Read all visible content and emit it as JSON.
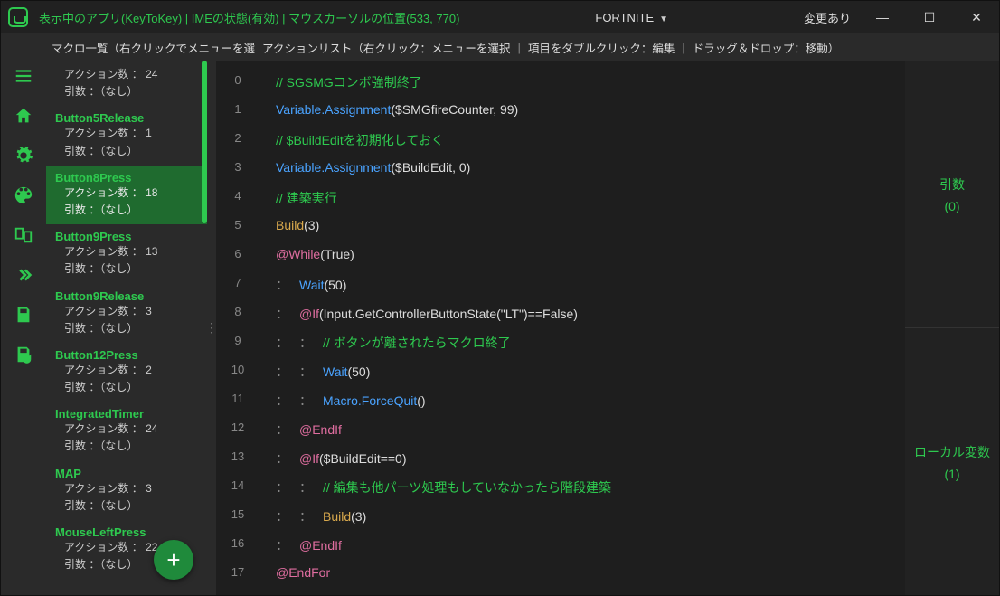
{
  "titlebar": {
    "status": "表示中のアプリ(KeyToKey)  |  IMEの状態(有効)  |  マウスカーソルの位置(533, 770)",
    "profile": "FORTNITE",
    "changed": "変更あり"
  },
  "subheader": {
    "left": "マクロ一覧（右クリックでメニューを選",
    "mid": "アクションリスト（右クリック：メニューを選択 ｜ 項目をダブルクリック：編集 ｜ ドラッグ＆ドロップ：移動）"
  },
  "macros": [
    {
      "name": "",
      "actions": "アクション数 ： 24",
      "args": "引数 ：（なし）",
      "partial": true
    },
    {
      "name": "Button5Release",
      "actions": "アクション数 ： 1",
      "args": "引数 ：（なし）"
    },
    {
      "name": "Button8Press",
      "actions": "アクション数 ： 18",
      "args": "引数 ：（なし）",
      "selected": true
    },
    {
      "name": "Button9Press",
      "actions": "アクション数 ： 13",
      "args": "引数 ：（なし）"
    },
    {
      "name": "Button9Release",
      "actions": "アクション数 ： 3",
      "args": "引数 ：（なし）"
    },
    {
      "name": "Button12Press",
      "actions": "アクション数 ： 2",
      "args": "引数 ：（なし）"
    },
    {
      "name": "IntegratedTimer",
      "actions": "アクション数 ： 24",
      "args": "引数 ：（なし）"
    },
    {
      "name": "MAP",
      "actions": "アクション数 ： 3",
      "args": "引数 ：（なし）"
    },
    {
      "name": "MouseLeftPress",
      "actions": "アクション数 ： 22",
      "args": "引数 ：（なし）"
    }
  ],
  "code": [
    {
      "n": 0,
      "indent": 0,
      "tokens": [
        {
          "t": "comment",
          "v": "// SGSMGコンボ強制終了"
        }
      ]
    },
    {
      "n": 1,
      "indent": 0,
      "tokens": [
        {
          "t": "func",
          "v": "Variable.Assignment"
        },
        {
          "t": "plain",
          "v": "($SMGfireCounter, 99)"
        }
      ]
    },
    {
      "n": 2,
      "indent": 0,
      "tokens": [
        {
          "t": "comment",
          "v": "// $BuildEditを初期化しておく"
        }
      ]
    },
    {
      "n": 3,
      "indent": 0,
      "tokens": [
        {
          "t": "func",
          "v": "Variable.Assignment"
        },
        {
          "t": "plain",
          "v": "($BuildEdit, 0)"
        }
      ]
    },
    {
      "n": 4,
      "indent": 0,
      "tokens": [
        {
          "t": "comment",
          "v": "// 建築実行"
        }
      ]
    },
    {
      "n": 5,
      "indent": 0,
      "tokens": [
        {
          "t": "call",
          "v": "Build"
        },
        {
          "t": "plain",
          "v": "(3)"
        }
      ]
    },
    {
      "n": 6,
      "indent": 0,
      "tokens": [
        {
          "t": "key",
          "v": "@While"
        },
        {
          "t": "plain",
          "v": " (True)"
        }
      ]
    },
    {
      "n": 7,
      "indent": 1,
      "tokens": [
        {
          "t": "func",
          "v": "Wait"
        },
        {
          "t": "plain",
          "v": "(50)"
        }
      ]
    },
    {
      "n": 8,
      "indent": 1,
      "tokens": [
        {
          "t": "key",
          "v": "@If"
        },
        {
          "t": "plain",
          "v": " (Input.GetControllerButtonState(\"LT\")==False)"
        }
      ]
    },
    {
      "n": 9,
      "indent": 2,
      "tokens": [
        {
          "t": "comment",
          "v": "// ボタンが離されたらマクロ終了"
        }
      ]
    },
    {
      "n": 10,
      "indent": 2,
      "tokens": [
        {
          "t": "func",
          "v": "Wait"
        },
        {
          "t": "plain",
          "v": "(50)"
        }
      ]
    },
    {
      "n": 11,
      "indent": 2,
      "tokens": [
        {
          "t": "func",
          "v": "Macro.ForceQuit"
        },
        {
          "t": "plain",
          "v": "()"
        }
      ]
    },
    {
      "n": 12,
      "indent": 1,
      "tokens": [
        {
          "t": "key",
          "v": "@EndIf"
        }
      ]
    },
    {
      "n": 13,
      "indent": 1,
      "tokens": [
        {
          "t": "key",
          "v": "@If"
        },
        {
          "t": "plain",
          "v": " ($BuildEdit==0)"
        }
      ]
    },
    {
      "n": 14,
      "indent": 2,
      "tokens": [
        {
          "t": "comment",
          "v": "// 編集も他パーツ処理もしていなかったら階段建築"
        }
      ]
    },
    {
      "n": 15,
      "indent": 2,
      "tokens": [
        {
          "t": "call",
          "v": "Build"
        },
        {
          "t": "plain",
          "v": "(3)"
        }
      ]
    },
    {
      "n": 16,
      "indent": 1,
      "tokens": [
        {
          "t": "key",
          "v": "@EndIf"
        }
      ]
    },
    {
      "n": 17,
      "indent": 0,
      "tokens": [
        {
          "t": "key",
          "v": "@EndFor"
        }
      ]
    }
  ],
  "right": {
    "args_label": "引数",
    "args_count": "(0)",
    "local_label": "ローカル変数",
    "local_count": "(1)"
  },
  "fab": "+"
}
